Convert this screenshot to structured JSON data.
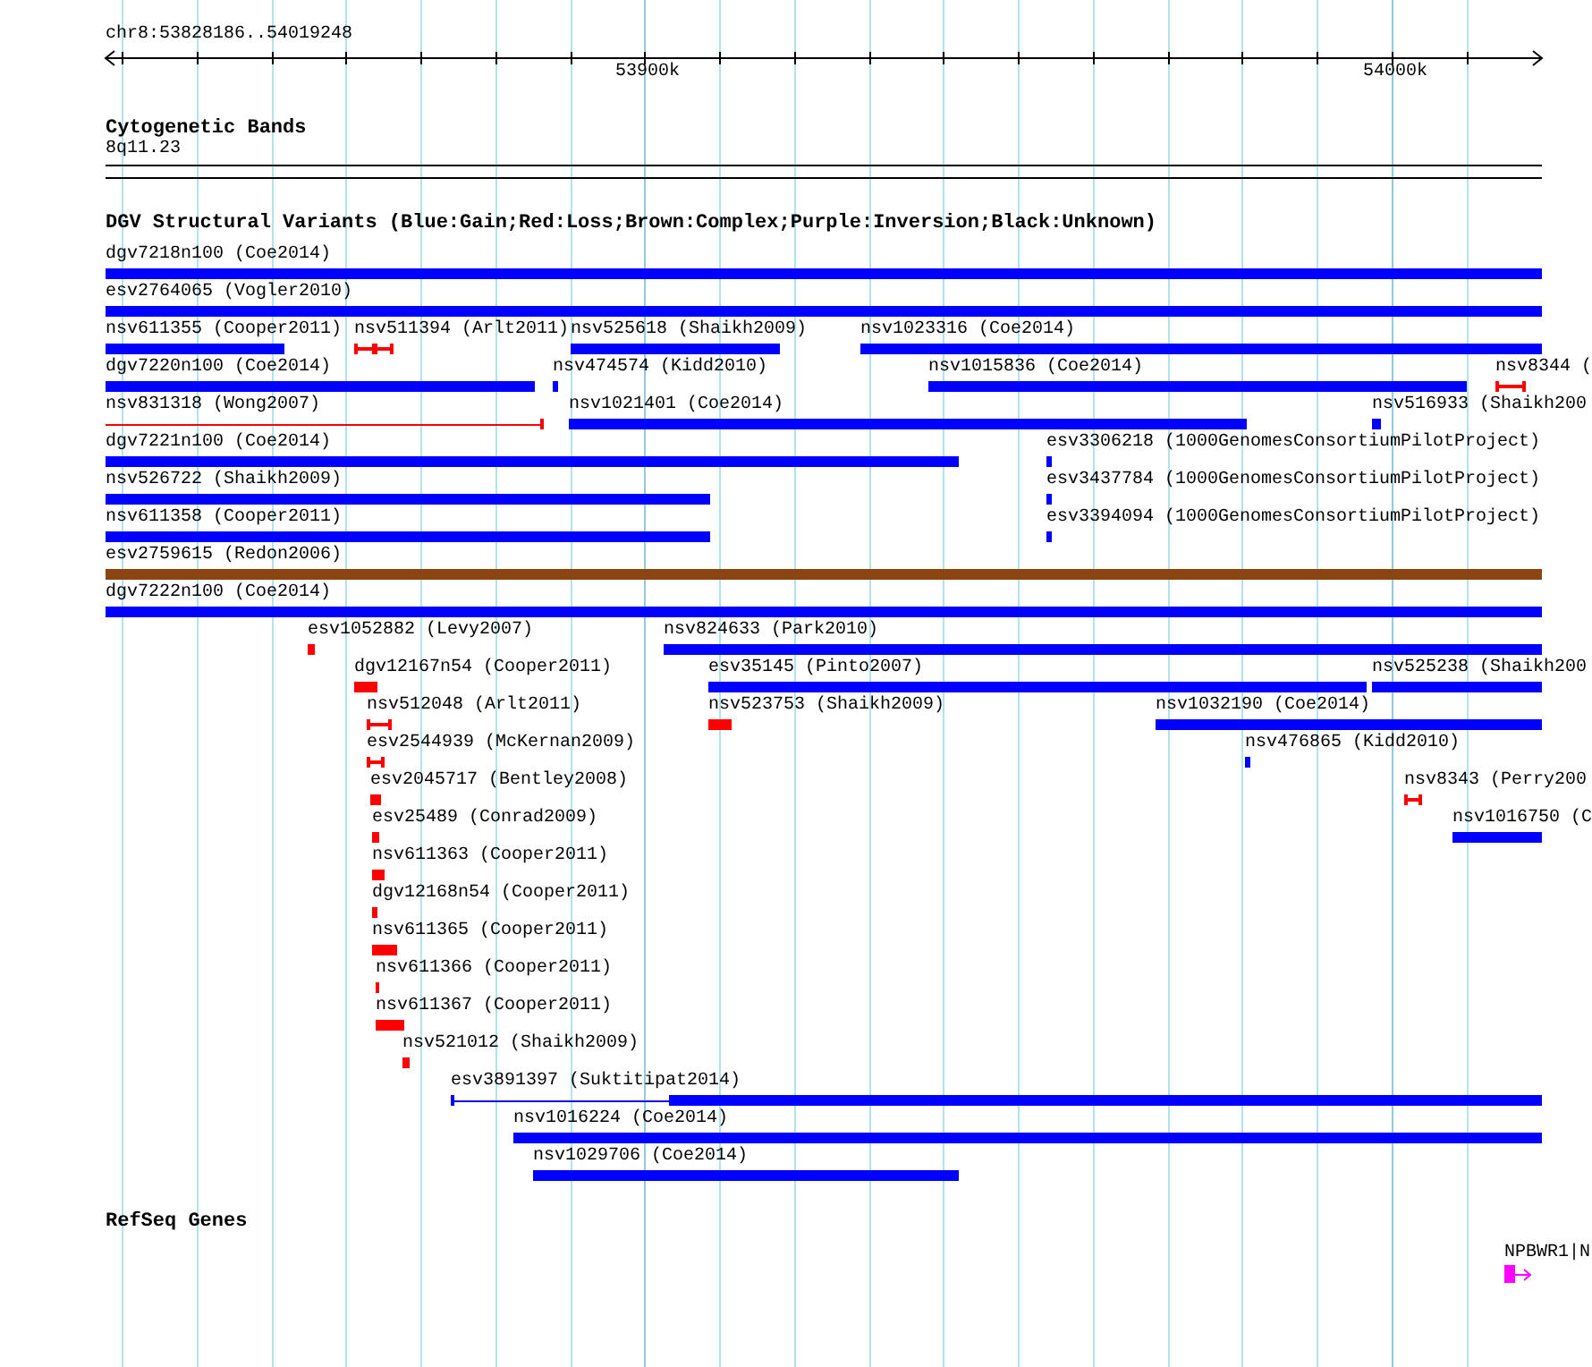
{
  "ruler": {
    "label": "chr8:53828186..54019248",
    "ticks": [
      {
        "label": "53900k"
      },
      {
        "label": "54000k"
      }
    ]
  },
  "cytogenetic_bands": {
    "title": "Cytogenetic Bands",
    "band": "8q11.23"
  },
  "dgv": {
    "title": "DGV Structural Variants (Blue:Gain;Red:Loss;Brown:Complex;Purple:Inversion;Black:Unknown)",
    "variants": [
      {
        "label": "dgv7218n100 (Coe2014)",
        "color": "#0000ff",
        "kind": "bar"
      },
      {
        "label": "esv2764065 (Vogler2010)",
        "color": "#0000ff",
        "kind": "bar"
      },
      {
        "label": "nsv611355 (Cooper2011)",
        "color": "#0000ff",
        "kind": "bar"
      },
      {
        "label": "nsv511394 (Arlt2011)",
        "color": "#ff0000",
        "kind": "interval"
      },
      {
        "label": "nsv525618 (Shaikh2009)",
        "color": "#0000ff",
        "kind": "bar"
      },
      {
        "label": "nsv1023316 (Coe2014)",
        "color": "#0000ff",
        "kind": "bar"
      },
      {
        "label": "dgv7220n100 (Coe2014)",
        "color": "#0000ff",
        "kind": "bar"
      },
      {
        "label": "nsv474574 (Kidd2010)",
        "color": "#0000ff",
        "kind": "bar"
      },
      {
        "label": "nsv1015836 (Coe2014)",
        "color": "#0000ff",
        "kind": "bar"
      },
      {
        "label": "nsv8344 (",
        "color": "#ff0000",
        "kind": "interval"
      },
      {
        "label": "nsv831318 (Wong2007)",
        "color": "#ff0000",
        "kind": "line"
      },
      {
        "label": "nsv1021401 (Coe2014)",
        "color": "#0000ff",
        "kind": "bar"
      },
      {
        "label": "nsv516933 (Shaikh200",
        "color": "#0000ff",
        "kind": "bar"
      },
      {
        "label": "dgv7221n100 (Coe2014)",
        "color": "#0000ff",
        "kind": "bar"
      },
      {
        "label": "esv3306218 (1000GenomesConsortiumPilotProject)",
        "color": "#0000ff",
        "kind": "bar"
      },
      {
        "label": "nsv526722 (Shaikh2009)",
        "color": "#0000ff",
        "kind": "bar"
      },
      {
        "label": "esv3437784 (1000GenomesConsortiumPilotProject)",
        "color": "#0000ff",
        "kind": "bar"
      },
      {
        "label": "nsv611358 (Cooper2011)",
        "color": "#0000ff",
        "kind": "bar"
      },
      {
        "label": "esv3394094 (1000GenomesConsortiumPilotProject)",
        "color": "#0000ff",
        "kind": "bar"
      },
      {
        "label": "esv2759615 (Redon2006)",
        "color": "#8b4513",
        "kind": "bar"
      },
      {
        "label": "dgv7222n100 (Coe2014)",
        "color": "#0000ff",
        "kind": "bar"
      },
      {
        "label": "esv1052882 (Levy2007)",
        "color": "#ff0000",
        "kind": "bar"
      },
      {
        "label": "nsv824633 (Park2010)",
        "color": "#0000ff",
        "kind": "bar"
      },
      {
        "label": "dgv12167n54 (Cooper2011)",
        "color": "#ff0000",
        "kind": "bar"
      },
      {
        "label": "esv35145 (Pinto2007)",
        "color": "#0000ff",
        "kind": "bar"
      },
      {
        "label": "nsv525238 (Shaikh200",
        "color": "#0000ff",
        "kind": "bar"
      },
      {
        "label": "nsv512048 (Arlt2011)",
        "color": "#ff0000",
        "kind": "interval"
      },
      {
        "label": "nsv523753 (Shaikh2009)",
        "color": "#ff0000",
        "kind": "bar"
      },
      {
        "label": "nsv1032190 (Coe2014)",
        "color": "#0000ff",
        "kind": "bar"
      },
      {
        "label": "esv2544939 (McKernan2009)",
        "color": "#ff0000",
        "kind": "interval"
      },
      {
        "label": "nsv476865 (Kidd2010)",
        "color": "#0000ff",
        "kind": "bar"
      },
      {
        "label": "esv2045717 (Bentley2008)",
        "color": "#ff0000",
        "kind": "bar"
      },
      {
        "label": "nsv8343 (Perry200",
        "color": "#ff0000",
        "kind": "interval"
      },
      {
        "label": "esv25489 (Conrad2009)",
        "color": "#ff0000",
        "kind": "bar"
      },
      {
        "label": "nsv1016750 (C",
        "color": "#0000ff",
        "kind": "bar"
      },
      {
        "label": "nsv611363 (Cooper2011)",
        "color": "#ff0000",
        "kind": "bar"
      },
      {
        "label": "dgv12168n54 (Cooper2011)",
        "color": "#ff0000",
        "kind": "bar"
      },
      {
        "label": "nsv611365 (Cooper2011)",
        "color": "#ff0000",
        "kind": "bar"
      },
      {
        "label": "nsv611366 (Cooper2011)",
        "color": "#ff0000",
        "kind": "bar"
      },
      {
        "label": "nsv611367 (Cooper2011)",
        "color": "#ff0000",
        "kind": "bar"
      },
      {
        "label": "nsv521012 (Shaikh2009)",
        "color": "#ff0000",
        "kind": "bar"
      },
      {
        "label": "esv3891397 (Suktitipat2014)",
        "color": "#0000ff",
        "kind": "mixed"
      },
      {
        "label": "nsv1016224 (Coe2014)",
        "color": "#0000ff",
        "kind": "bar"
      },
      {
        "label": "nsv1029706 (Coe2014)",
        "color": "#0000ff",
        "kind": "bar"
      }
    ]
  },
  "refseq_genes": {
    "title": "RefSeq Genes",
    "genes": [
      {
        "label": "NPBWR1|N",
        "color": "#ff00ff"
      }
    ]
  }
}
